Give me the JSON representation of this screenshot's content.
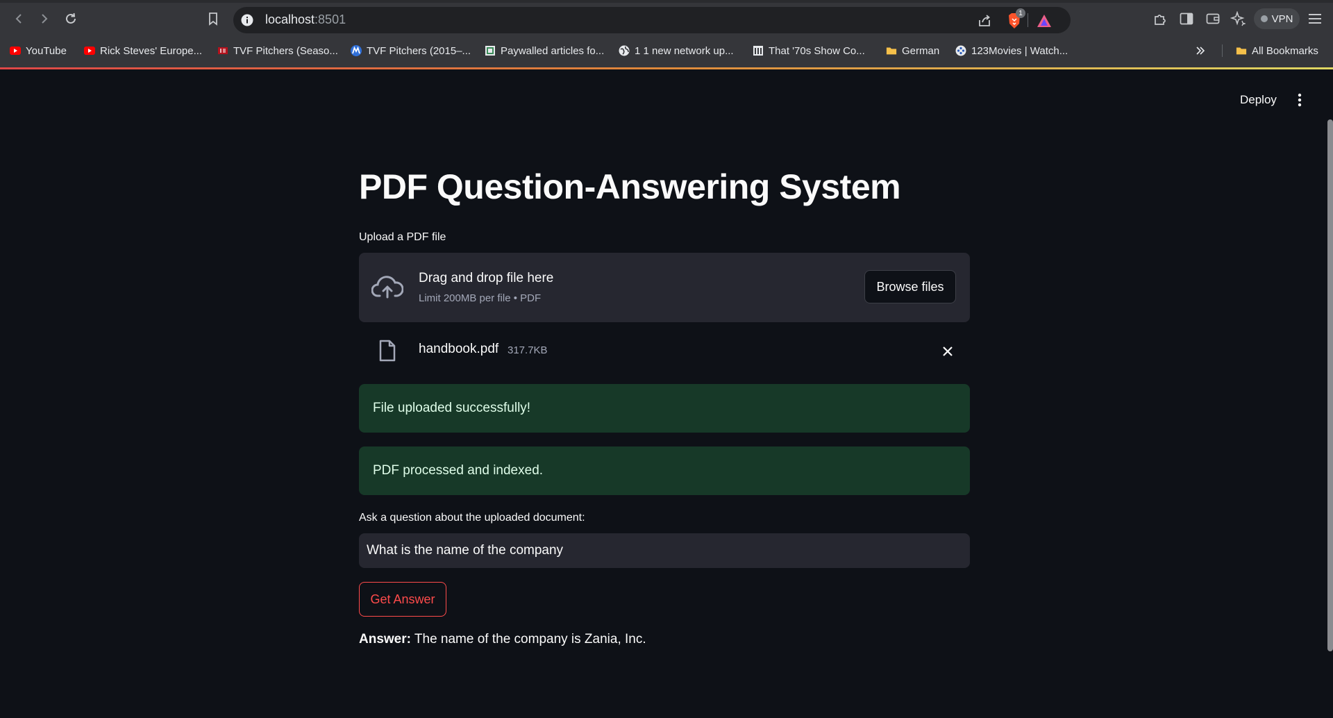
{
  "browser": {
    "url_host": "localhost",
    "url_port": ":8501",
    "vpn_label": "VPN",
    "brave_badge": "1",
    "bookmarks": [
      {
        "label": "YouTube",
        "icon": "youtube-icon"
      },
      {
        "label": "Rick Steves' Europe...",
        "icon": "youtube-icon"
      },
      {
        "label": "TVF Pitchers (Seaso...",
        "icon": "imdb-icon"
      },
      {
        "label": "TVF Pitchers (2015–...",
        "icon": "m-logo-icon"
      },
      {
        "label": "Paywalled articles fo...",
        "icon": "article-icon"
      },
      {
        "label": "1 1 new network up...",
        "icon": "globe-icon"
      },
      {
        "label": "That '70s Show Co...",
        "icon": "building-icon"
      },
      {
        "label": "German",
        "icon": "folder-icon"
      },
      {
        "label": "123Movies | Watch...",
        "icon": "film-reel-icon"
      }
    ],
    "all_bookmarks_label": "All Bookmarks"
  },
  "app": {
    "deploy_label": "Deploy",
    "title": "PDF Question-Answering System",
    "upload_label": "Upload a PDF file",
    "dropzone_main": "Drag and drop file here",
    "dropzone_sub": "Limit 200MB per file • PDF",
    "browse_label": "Browse files",
    "file": {
      "name": "handbook.pdf",
      "size": "317.7KB"
    },
    "alerts": [
      "File uploaded successfully!",
      "PDF processed and indexed."
    ],
    "question_label": "Ask a question about the uploaded document:",
    "question_value": "What is the name of the company",
    "get_answer_label": "Get Answer",
    "answer_prefix": "Answer:",
    "answer_text": " The name of the company is Zania, Inc."
  },
  "colors": {
    "background": "#0e1117",
    "widget": "#262730",
    "success_bg": "#173928",
    "success_text": "#dffde9",
    "primary": "#ff4b4b"
  }
}
